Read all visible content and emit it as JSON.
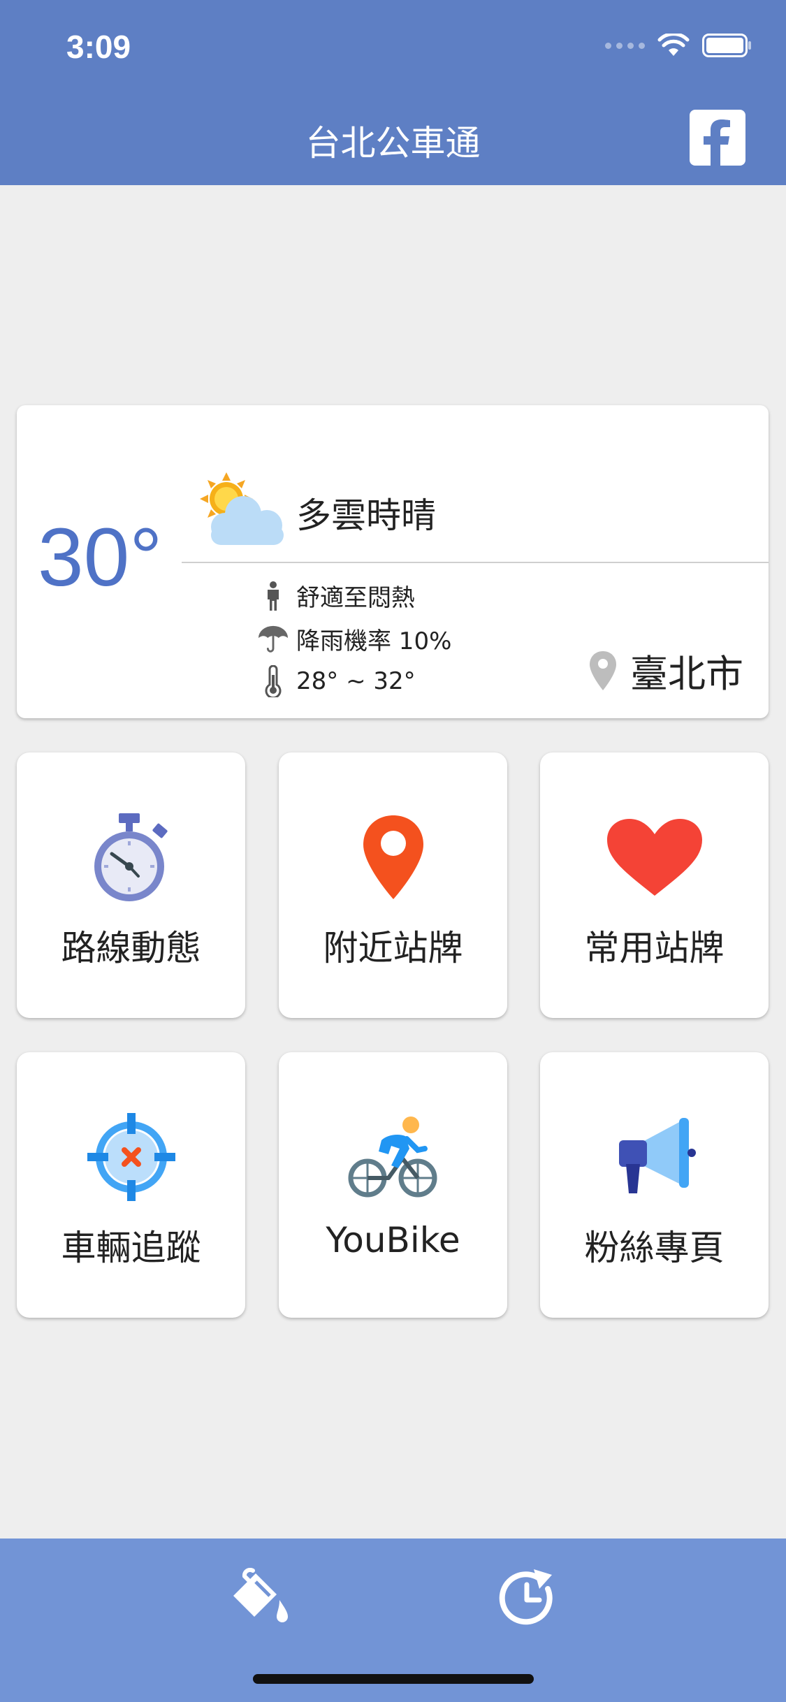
{
  "status_bar": {
    "time": "3:09"
  },
  "nav": {
    "title": "台北公車通",
    "facebook_icon": "facebook-icon"
  },
  "weather": {
    "temperature": "30°",
    "condition": "多雲時晴",
    "comfort": "舒適至悶熱",
    "rain_chance": "降雨機率 10%",
    "temp_range": "28° ~ 32°",
    "location": "臺北市",
    "accent_color": "#4f72c6"
  },
  "tiles": [
    {
      "label": "路線動態",
      "icon": "stopwatch-icon"
    },
    {
      "label": "附近站牌",
      "icon": "location-pin-icon"
    },
    {
      "label": "常用站牌",
      "icon": "heart-icon"
    },
    {
      "label": "車輛追蹤",
      "icon": "crosshair-icon"
    },
    {
      "label": "YouBike",
      "icon": "cyclist-icon"
    },
    {
      "label": "粉絲專頁",
      "icon": "megaphone-icon"
    }
  ],
  "bottom_bar": {
    "left_icon": "paint-bucket-icon",
    "right_icon": "history-icon"
  },
  "colors": {
    "bar": "#5e7fc4",
    "bottom_bar": "#7294d6",
    "background": "#eeeeee"
  }
}
